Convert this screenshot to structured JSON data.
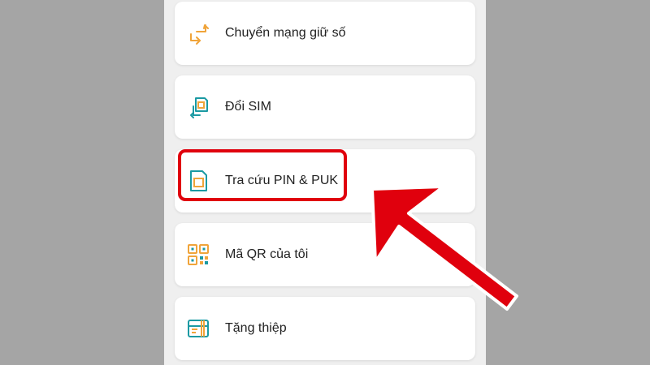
{
  "colors": {
    "page_background": "#a5a5a5",
    "panel_background": "#efefef",
    "icon_orange": "#f0a43a",
    "icon_teal": "#1b9aa3",
    "annotation_red": "#e0000d"
  },
  "menu": {
    "items": [
      {
        "label": "Chuyển mạng giữ số",
        "icon": "swap-arrows-icon"
      },
      {
        "label": "Đổi SIM",
        "icon": "sim-swap-icon"
      },
      {
        "label": "Tra cứu PIN & PUK",
        "icon": "sim-card-icon"
      },
      {
        "label": "Mã QR của tôi",
        "icon": "qr-code-icon"
      },
      {
        "label": "Tặng thiệp",
        "icon": "gift-card-icon"
      }
    ]
  }
}
